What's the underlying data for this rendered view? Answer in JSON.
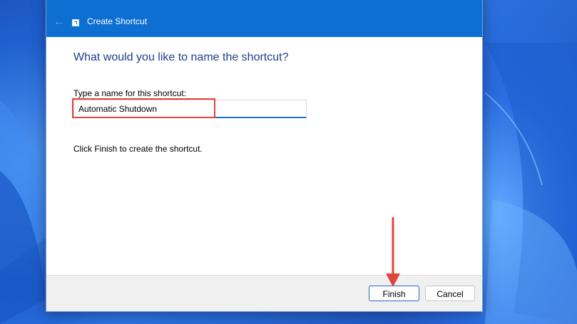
{
  "window": {
    "title": "Create Shortcut",
    "back_icon": "arrow-left-icon",
    "close_icon": "close-icon",
    "app_icon": "shortcut-icon"
  },
  "content": {
    "heading": "What would you like to name the shortcut?",
    "field_label": "Type a name for this shortcut:",
    "name_value": "Automatic Shutdown",
    "instruction": "Click Finish to create the shortcut."
  },
  "footer": {
    "finish_label": "Finish",
    "cancel_label": "Cancel"
  },
  "colors": {
    "titlebar": "#0d6fd1",
    "heading": "#1e3e8c",
    "annotation": "#e0463c"
  }
}
